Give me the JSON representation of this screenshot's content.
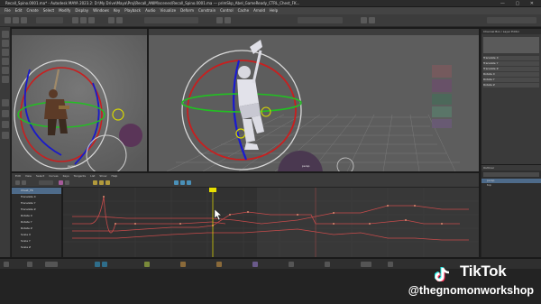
{
  "window": {
    "title": "Recall_Spino.0001.ma* - Autodesk MAYA 2023.2: D:\\My Drive\\Maya\\Proj\\Recall_ANIM\\scenes\\Recall_Spino.0001.ma --- primSkp_Abel_GameReady_CTRL_Chest_FK...",
    "controls": "— ▢ ✕"
  },
  "menu": [
    "File",
    "Edit",
    "Create",
    "Select",
    "Modify",
    "Display",
    "Windows",
    "Key",
    "Playback",
    "Audio",
    "Visualize",
    "Deform",
    "Constrain",
    "Control",
    "Cache",
    "Arnold",
    "Help"
  ],
  "viewports": {
    "left_camera": "persp",
    "right_camera": "persp"
  },
  "graph_editor": {
    "menu": [
      "Edit",
      "View",
      "Select",
      "Curves",
      "Keys",
      "Tangents",
      "List",
      "Show",
      "Help"
    ],
    "outliner_rows": [
      "Chest_FK",
      "Translate X",
      "Translate Y",
      "Translate Z",
      "Rotate X",
      "Rotate Y",
      "Rotate Z",
      "Scale X",
      "Scale Y",
      "Scale Z"
    ],
    "selected_row_index": 0
  },
  "channel_box": {
    "tabs": [
      "Channel Box / Layer Editor"
    ],
    "rows": [
      "Translate X",
      "Translate Y",
      "Translate Z",
      "Rotate X",
      "Rotate Y",
      "Rotate Z"
    ]
  },
  "outliner": {
    "title": "Outliner",
    "items": [
      "persp",
      "top"
    ]
  },
  "watermark": {
    "brand": "TikTok",
    "handle": "@thegnomonworkshop"
  },
  "colors": {
    "maya_bg": "#444444",
    "viewport_grid": "#5c5c5c",
    "curve_red": "#c84b4b",
    "time_marker": "#e8e000",
    "selection_blue": "#4e6b8a"
  }
}
